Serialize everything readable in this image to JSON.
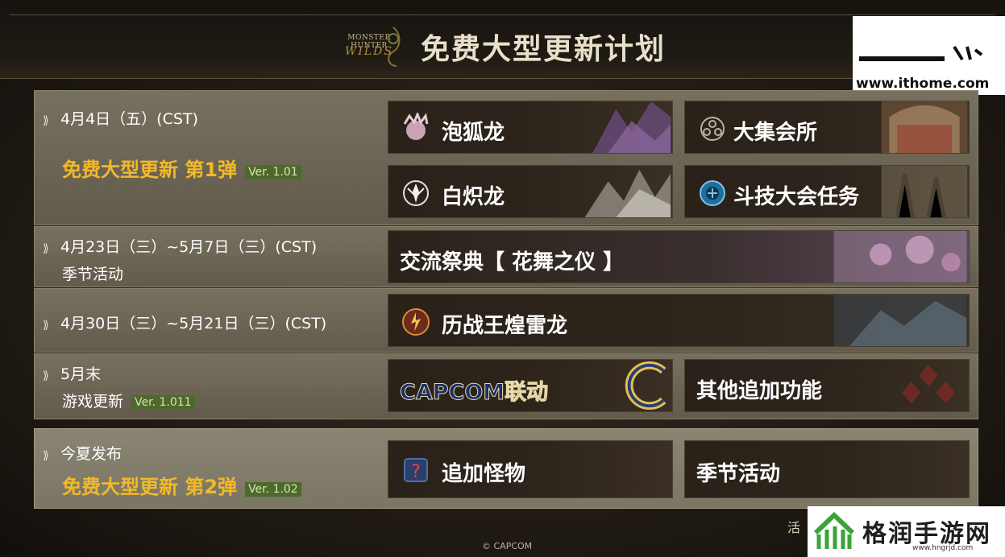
{
  "header": {
    "logo_line1": "MONSTER HUNTER",
    "logo_line2": "WILDS",
    "title": "免费大型更新计划"
  },
  "watermarks": {
    "site_url": "www.ithome.com",
    "brand_title": "格润手游网",
    "brand_url": "www.hngrjd.com"
  },
  "rows": [
    {
      "date": "4月4日（五）(CST)",
      "subtitle": "免费大型更新 第1弹",
      "version": "Ver. 1.01",
      "cards": [
        "泡狐龙",
        "大集会所",
        "白炽龙",
        "斗技大会任务"
      ]
    },
    {
      "date": "4月23日（三）~5月7日（三）(CST)",
      "subtitle": "季节活动",
      "cards": [
        "交流祭典【 花舞之仪 】"
      ]
    },
    {
      "date": "4月30日（三）~5月21日（三）(CST)",
      "cards": [
        "历战王煌雷龙"
      ]
    },
    {
      "date": "5月末",
      "subtitle": "游戏更新",
      "version": "Ver. 1.011",
      "cards": [
        "CAPCOM联动",
        "其他追加功能"
      ]
    },
    {
      "date": "今夏发布",
      "subtitle": "免费大型更新 第2弹",
      "version": "Ver. 1.02",
      "cards": [
        "追加怪物",
        "季节活动"
      ]
    }
  ],
  "footer": {
    "copyright": "© CAPCOM",
    "note": "活"
  },
  "colors": {
    "gold": "#f3b92a",
    "version_badge": "#4d6a2c",
    "card_bg": "#2a2219"
  }
}
